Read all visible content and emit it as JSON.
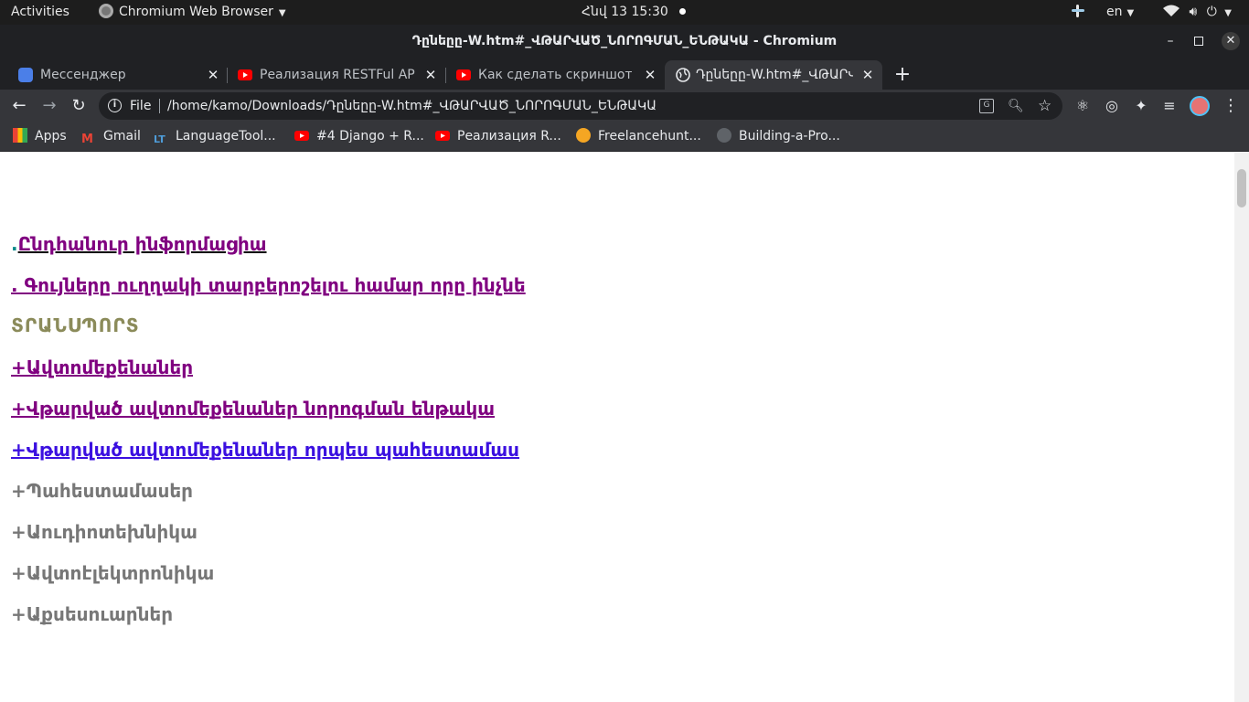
{
  "system_bar": {
    "activities": "Activities",
    "app_name": "Chromium Web Browser",
    "clock": "Հնվ 13  15:30",
    "language": "en"
  },
  "window": {
    "title": "Դընեըը-W.htm#_ՎԹԱՐՎԱԾ_ՆՈՐՈԳՄԱՆ_ԵՆԹԱԿԱ - Chromium"
  },
  "tabs": [
    {
      "title": "Мессенджер",
      "icon": "messenger-icon",
      "active": false
    },
    {
      "title": "Реализация RESTFul API c",
      "icon": "youtube-icon",
      "active": false
    },
    {
      "title": "Как сделать скриншот в U",
      "icon": "youtube-icon",
      "active": false
    },
    {
      "title": "Դընեըը-W.htm#_ՎԹԱՐՎ",
      "icon": "globe-icon",
      "active": true
    }
  ],
  "omnibox": {
    "scheme_label": "File",
    "url": "/home/kamo/Downloads/Դընեըը-W.htm#_ՎԹԱՐՎԱԾ_ՆՈՐՈԳՄԱՆ_ԵՆԹԱԿԱ"
  },
  "bookmarks": [
    {
      "label": "Apps",
      "icon": "apps-grid-icon"
    },
    {
      "label": "Gmail",
      "icon": "gmail-icon"
    },
    {
      "label": "LanguageTool...",
      "icon": "languagetool-icon"
    },
    {
      "label": "#4 Django + R...",
      "icon": "youtube-icon"
    },
    {
      "label": "Реализация R...",
      "icon": "youtube-icon"
    },
    {
      "label": "Freelancehunt...",
      "icon": "freelancehunt-icon"
    },
    {
      "label": "Building-a-Pro...",
      "icon": "github-icon"
    }
  ],
  "content": {
    "dot_prefix": ".",
    "lines": [
      {
        "text": "Ընդհանուր ինֆորմացիա",
        "color": "#800080",
        "link": true
      },
      {
        "text": ". Գույները ուղղակի տարբերոշելու համար որը ինչնե",
        "color": "#800080",
        "link": true
      },
      {
        "text": "ՏՐԱՆՍՊՈՐՏ",
        "color": "#8b8b5a",
        "link": false
      },
      {
        "text": "+Ավտոմեքենաներ",
        "color": "#800080",
        "link": true
      },
      {
        "text": "+Վթարված ավտոմեքենաներ նորոգման ենթակա",
        "color": "#800080",
        "link": true
      },
      {
        "text": "+Վթարված ավտոմեքենաներ որպես պահեստամաս",
        "color": "#3b10e0",
        "link": true
      },
      {
        "text": "+Պահեստամասեր",
        "color": "#777777",
        "link": false
      },
      {
        "text": "+Աուդիոտեխնիկա",
        "color": "#777777",
        "link": false
      },
      {
        "text": "+Ավտոէլեկտրոնիկա",
        "color": "#777777",
        "link": false
      },
      {
        "text": "+Աքսեսուարներ",
        "color": "#777777",
        "link": false
      }
    ]
  }
}
